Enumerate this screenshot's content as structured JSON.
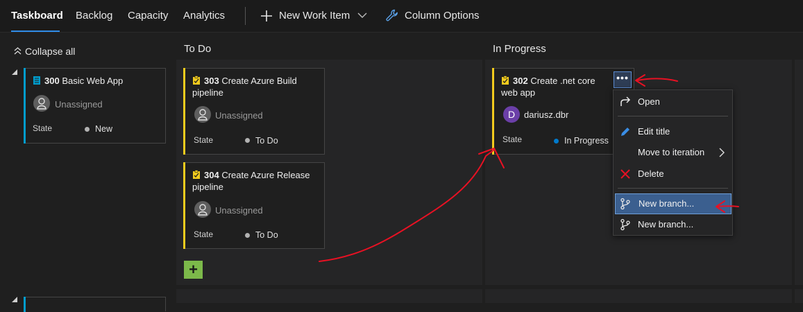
{
  "nav": {
    "tabs": [
      {
        "label": "Taskboard",
        "active": true
      },
      {
        "label": "Backlog"
      },
      {
        "label": "Capacity"
      },
      {
        "label": "Analytics"
      }
    ],
    "new_work_item": "New Work Item",
    "column_options": "Column Options"
  },
  "collapse_all": "Collapse all",
  "columns": [
    "To Do",
    "In Progress"
  ],
  "colors": {
    "accent_blue": "#2f8ce8",
    "task_yellow": "#f2cb1d",
    "pbi_blue": "#009ccc",
    "state_new": "#b2b2b2",
    "state_in_progress": "#007acc",
    "add_button_green": "#7cb94a",
    "annotation_red": "#e81123"
  },
  "backlog_item": {
    "id": "300",
    "title": "Basic Web App",
    "assignee": "Unassigned",
    "state_label": "State",
    "state": "New"
  },
  "todo_cards": [
    {
      "id": "303",
      "title": "Create Azure Build pipeline",
      "assignee": "Unassigned",
      "state_label": "State",
      "state": "To Do"
    },
    {
      "id": "304",
      "title": "Create Azure Release pipeline",
      "assignee": "Unassigned",
      "state_label": "State",
      "state": "To Do"
    }
  ],
  "inprogress_card": {
    "id": "302",
    "title": "Create .net core web app",
    "assignee": "dariusz.dbr",
    "avatar_letter": "D",
    "state_label": "State",
    "state": "In Progress",
    "more_label": "•••"
  },
  "context_menu": {
    "items": [
      {
        "label": "Open",
        "icon": "open-icon"
      },
      {
        "label": "Edit title",
        "icon": "pencil-icon"
      },
      {
        "label": "Move to iteration",
        "icon": "chevron-right-icon"
      },
      {
        "label": "Delete",
        "icon": "x-icon"
      },
      {
        "label": "New branch...",
        "icon": "branch-icon",
        "highlighted": true
      },
      {
        "label": "New branch...",
        "icon": "branch-icon"
      }
    ]
  },
  "add_label": "+"
}
